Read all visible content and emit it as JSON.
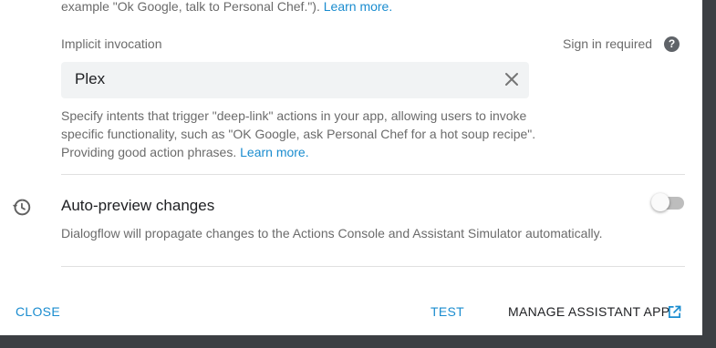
{
  "intro": {
    "text": "example \"Ok Google, talk to Personal Chef.\"). ",
    "link": "Learn more."
  },
  "implicit": {
    "label": "Implicit invocation",
    "sign_in": "Sign in required",
    "help_icon": "?",
    "input_value": "Plex",
    "description": "Specify intents that trigger \"deep-link\" actions in your app, allowing users to invoke specific functionality, such as \"OK Google, ask Personal Chef for a hot soup recipe\". Providing good action phrases. ",
    "link": "Learn more."
  },
  "autopreview": {
    "title": "Auto-preview changes",
    "description": "Dialogflow will propagate changes to the Actions Console and Assistant Simulator automatically.",
    "enabled": false
  },
  "footer": {
    "close": "CLOSE",
    "test": "TEST",
    "manage": "MANAGE ASSISTANT APP"
  },
  "icons": {
    "help": "help-circle-icon",
    "clear": "close-icon",
    "history": "history-icon",
    "external": "open-in-new-icon"
  },
  "colors": {
    "link": "#1a8ccf",
    "text_primary": "#202124",
    "text_secondary": "#6b6b6b",
    "input_bg": "#f1f3f4",
    "backdrop": "#3c3f43"
  }
}
